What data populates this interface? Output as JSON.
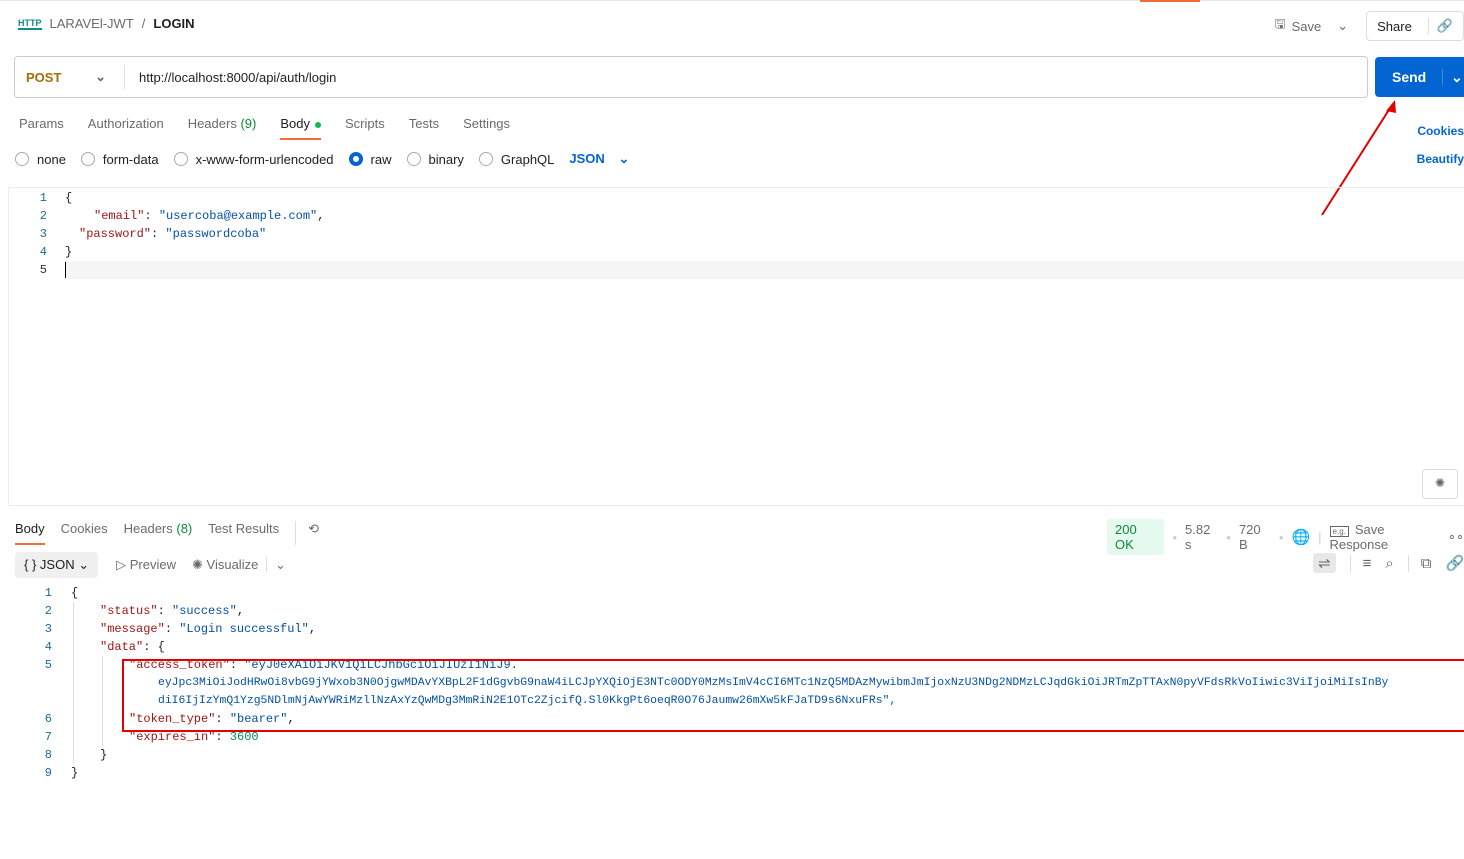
{
  "header": {
    "collection": "LARAVEl-JWT",
    "separator": "/",
    "request": "LOGIN",
    "save": "Save",
    "share": "Share",
    "http_icon": "HTTP"
  },
  "request": {
    "method": "POST",
    "url": "http://localhost:8000/api/auth/login",
    "send": "Send"
  },
  "request_tabs": [
    {
      "label": "Params"
    },
    {
      "label": "Authorization"
    },
    {
      "label": "Headers",
      "count": "(9)"
    },
    {
      "label": "Body"
    },
    {
      "label": "Scripts"
    },
    {
      "label": "Tests"
    },
    {
      "label": "Settings"
    }
  ],
  "side_links": {
    "cookies": "Cookies",
    "beautify": "Beautify"
  },
  "body_types": [
    {
      "label": "none"
    },
    {
      "label": "form-data"
    },
    {
      "label": "x-www-form-urlencoded"
    },
    {
      "label": "raw",
      "selected": true
    },
    {
      "label": "binary"
    },
    {
      "label": "GraphQL"
    }
  ],
  "body_format": "JSON",
  "request_body": {
    "line_numbers": [
      "1",
      "2",
      "3",
      "4",
      "5"
    ],
    "open": "{",
    "close": "}",
    "email_key": "\"email\"",
    "email_val": "\"usercoba@example.com\"",
    "password_key": "\"password\"",
    "password_val": "\"passwordcoba\""
  },
  "response_tabs": [
    {
      "label": "Body"
    },
    {
      "label": "Cookies"
    },
    {
      "label": "Headers",
      "count": "(8)"
    },
    {
      "label": "Test Results"
    }
  ],
  "response_meta": {
    "status": "200 OK",
    "time": "5.82 s",
    "size": "720 B",
    "save_response": "Save Response",
    "eg": "e.g."
  },
  "response_format": {
    "format": "JSON",
    "preview": "Preview",
    "visualize": "Visualize"
  },
  "response_body": {
    "line_numbers": [
      "1",
      "2",
      "3",
      "4",
      "5",
      "6",
      "7",
      "8",
      "9"
    ],
    "status_key": "\"status\"",
    "status_val": "\"success\"",
    "message_key": "\"message\"",
    "message_val": "\"Login successful\"",
    "data_key": "\"data\"",
    "token_key": "\"access_token\"",
    "token_line1": "\"eyJ0eXAiOiJKV1QiLCJhbGciOiJIUzI1NiJ9.",
    "token_line2": "eyJpc3MiOiJodHRwOi8vbG9jYWxob3N0OjgwMDAvYXBpL2F1dGgvbG9naW4iLCJpYXQiOjE3NTc0ODY0MzMsImV4cCI6MTc1NzQ5MDAzMywibmJmIjoxNzU3NDg2NDMzLCJqdGkiOiJRTmZpTTAxN0pyVFdsRkVoIiwic3ViIjoiMiIsInBy",
    "token_line3": "diI6IjIzYmQ1Yzg5NDlmNjAwYWRiMzllNzAxYzQwMDg3MmRiN2E1OTc2ZjcifQ.Sl0KkgPt6oeqR0O76Jaumw26mXw5kFJaTD9s6NxuFRs\",",
    "token_type_key": "\"token_type\"",
    "token_type_val": "\"bearer\"",
    "expires_key": "\"expires_in\"",
    "expires_val": "3600"
  }
}
